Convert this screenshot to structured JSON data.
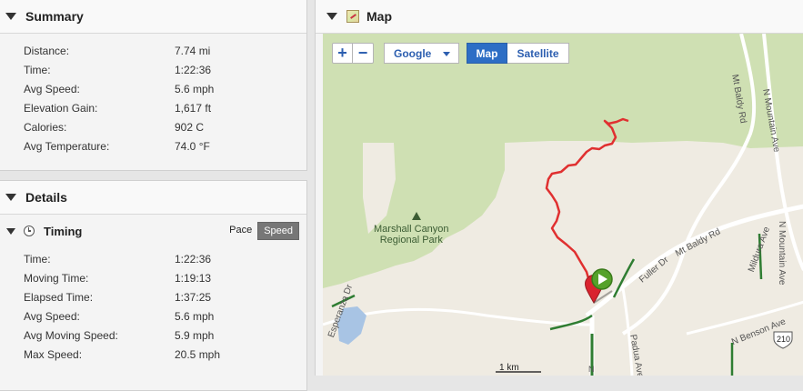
{
  "summary": {
    "title": "Summary",
    "rows": [
      {
        "label": "Distance:",
        "value": "7.74 mi"
      },
      {
        "label": "Time:",
        "value": "1:22:36"
      },
      {
        "label": "Avg Speed:",
        "value": "5.6 mph"
      },
      {
        "label": "Elevation Gain:",
        "value": "1,617 ft"
      },
      {
        "label": "Calories:",
        "value": "902 C"
      },
      {
        "label": "Avg Temperature:",
        "value": "74.0 °F"
      }
    ]
  },
  "details": {
    "title": "Details",
    "timing": {
      "title": "Timing",
      "toggle": {
        "pace": "Pace",
        "speed": "Speed",
        "selected": "Speed"
      },
      "rows": [
        {
          "label": "Time:",
          "value": "1:22:36"
        },
        {
          "label": "Moving Time:",
          "value": "1:19:13"
        },
        {
          "label": "Elapsed Time:",
          "value": "1:37:25"
        },
        {
          "label": "Avg Speed:",
          "value": "5.6 mph"
        },
        {
          "label": "Avg Moving Speed:",
          "value": "5.9 mph"
        },
        {
          "label": "Max Speed:",
          "value": "20.5 mph"
        }
      ]
    }
  },
  "map": {
    "title": "Map",
    "controls": {
      "zoom_in": "+",
      "zoom_out": "−",
      "provider": "Google",
      "type_map": "Map",
      "type_satellite": "Satellite",
      "selected_type": "Map"
    },
    "labels": {
      "park_line1": "Marshall Canyon",
      "park_line2": "Regional Park",
      "mt_baldy_rd_top": "Mt Baldy Rd",
      "n_mountain_ave_top": "N Mountain Ave",
      "mt_baldy_rd_mid": "Mt Baldy Rd",
      "n_mountain_ave_right": "N Mountain Ave",
      "fuller_dr": "Fuller Dr",
      "padua_ave": "Padua Ave",
      "esperanza_dr": "Esperanza Dr",
      "n_benson_ave": "N Benson Ave",
      "mildura_ave": "Mildura Ave",
      "route_shield": "210",
      "scale": "1 km",
      "n_road_stub": "N"
    },
    "colors": {
      "route": "#e03030",
      "park_green": "#cfe0b3",
      "background": "#efebe2",
      "start_marker": "#55a12a",
      "end_marker": "#d9232e",
      "accent_blue": "#2d6ec5"
    }
  }
}
